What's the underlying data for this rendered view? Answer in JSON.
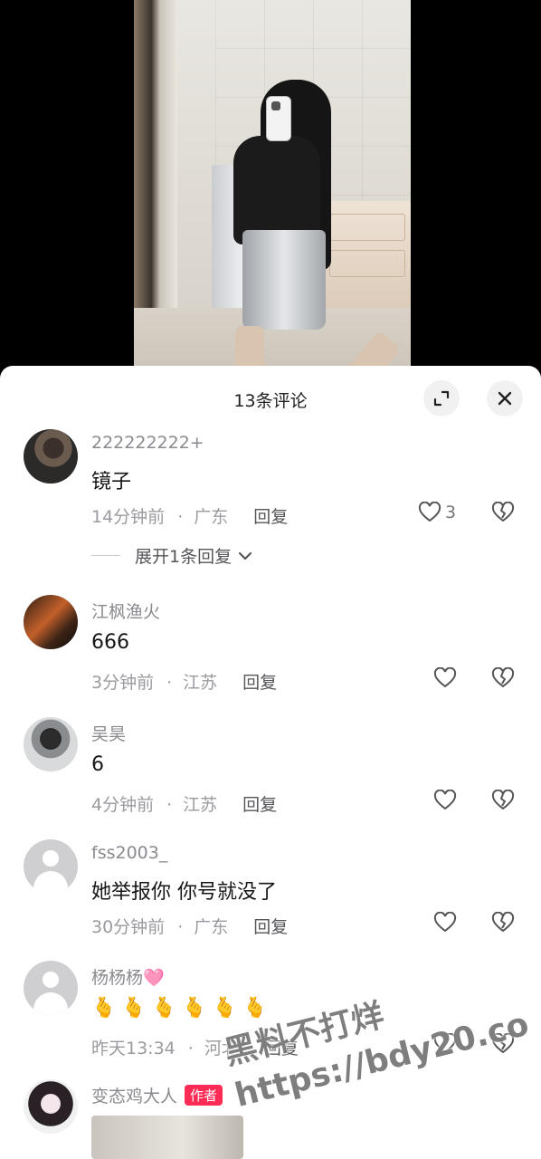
{
  "sheet": {
    "title": "13条评论"
  },
  "comments": [
    {
      "user": "222222222+",
      "text": "镜子",
      "time": "14分钟前",
      "location": "广东",
      "reply_label": "回复",
      "likes": "3",
      "expand_label": "展开1条回复"
    },
    {
      "user": "江枫渔火",
      "text": "666",
      "time": "3分钟前",
      "location": "江苏",
      "reply_label": "回复"
    },
    {
      "user": "吴昊",
      "text": "6",
      "time": "4分钟前",
      "location": "江苏",
      "reply_label": "回复"
    },
    {
      "user": "fss2003_",
      "text": "她举报你 你号就没了",
      "time": "30分钟前",
      "location": "广东",
      "reply_label": "回复"
    },
    {
      "user": "杨杨杨🩷",
      "text": "🫰🫰🫰🫰🫰🫰",
      "time": "昨天13:34",
      "location": "河北",
      "reply_label": "回复"
    },
    {
      "user": "变态鸡大人",
      "badge": "作者"
    }
  ],
  "watermark": {
    "line1": "黑料不打烊",
    "line2": "https://bdy20.co"
  },
  "colors": {
    "accent": "#fe2c55",
    "muted_text": "#8a8a90",
    "sheet_bg": "#ffffff"
  },
  "icons": {
    "expand": "expand-arrows-icon",
    "close": "close-icon",
    "like": "heart-outline-icon",
    "dislike": "broken-heart-icon",
    "chevron": "chevron-down-icon"
  }
}
